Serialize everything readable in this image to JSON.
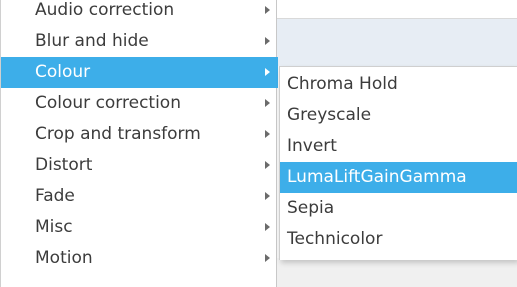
{
  "left_menu": {
    "items": [
      {
        "label": "Audio correction",
        "has_submenu": true,
        "active": false
      },
      {
        "label": "Blur and hide",
        "has_submenu": true,
        "active": false
      },
      {
        "label": "Colour",
        "has_submenu": true,
        "active": true
      },
      {
        "label": "Colour correction",
        "has_submenu": true,
        "active": false
      },
      {
        "label": "Crop and transform",
        "has_submenu": true,
        "active": false
      },
      {
        "label": "Distort",
        "has_submenu": true,
        "active": false
      },
      {
        "label": "Fade",
        "has_submenu": true,
        "active": false
      },
      {
        "label": "Misc",
        "has_submenu": true,
        "active": false
      },
      {
        "label": "Motion",
        "has_submenu": true,
        "active": false
      }
    ]
  },
  "submenu": {
    "items": [
      {
        "label": "Chroma Hold",
        "active": false
      },
      {
        "label": "Greyscale",
        "active": false
      },
      {
        "label": "Invert",
        "active": false
      },
      {
        "label": "LumaLiftGainGamma",
        "active": true
      },
      {
        "label": "Sepia",
        "active": false
      },
      {
        "label": "Technicolor",
        "active": false
      }
    ]
  },
  "colors": {
    "highlight": "#3daee9",
    "text": "#3c3c3c",
    "highlight_text": "#ffffff"
  },
  "icons": {
    "submenu_arrow": "chevron-right-icon"
  }
}
